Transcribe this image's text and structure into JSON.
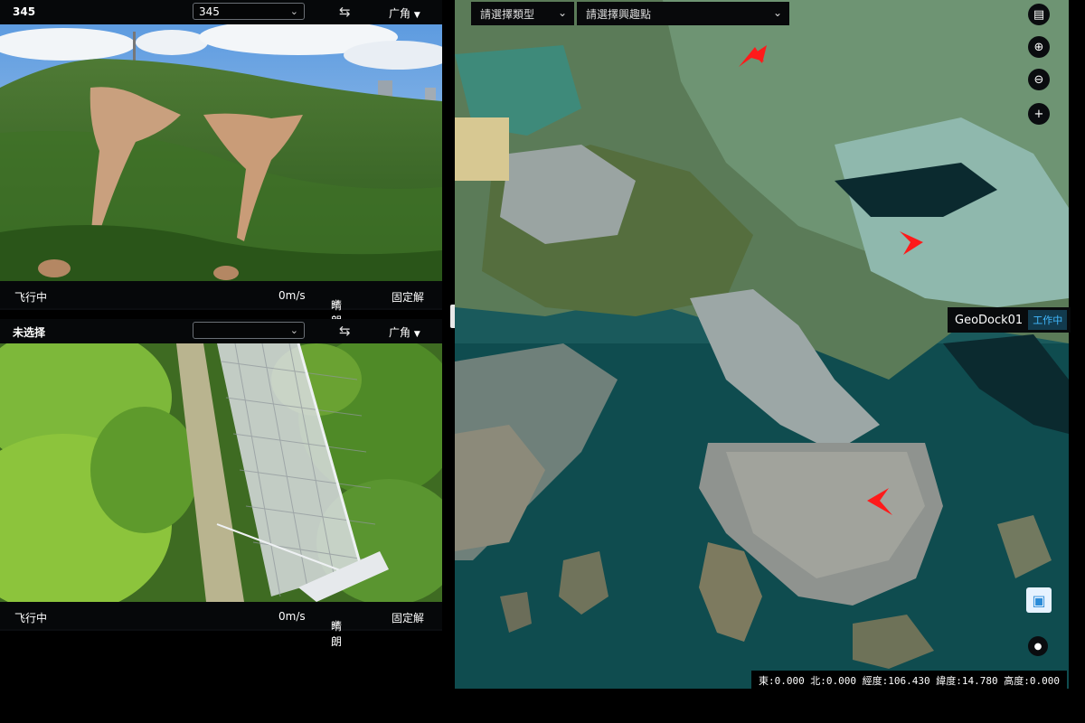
{
  "camera1": {
    "title": "345",
    "select_value": "345",
    "swap_icon": "⇆",
    "lens_label": "广角",
    "status": {
      "flight": "飞行中",
      "speed": "0m/s",
      "weather": "晴朗",
      "mode": "固定解"
    }
  },
  "camera2": {
    "title": "未选择",
    "select_value": "",
    "swap_icon": "⇆",
    "lens_label": "广角",
    "status": {
      "flight": "飞行中",
      "speed": "0m/s",
      "weather": "晴朗",
      "mode": "固定解"
    }
  },
  "map": {
    "select_type_placeholder": "請選擇類型",
    "select_point_placeholder": "請選擇興趣點",
    "dock": {
      "name": "GeoDock01",
      "status": "工作中"
    },
    "coords": "東:0.000 北:0.000 經度:106.430 緯度:14.780 高度:0.000",
    "colors": {
      "marker": "#ff1a1a",
      "accent": "#41b9ff"
    }
  }
}
